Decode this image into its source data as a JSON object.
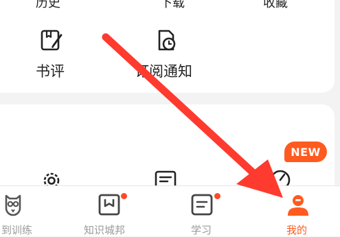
{
  "top_row": {
    "history_label": "历史",
    "download_label": "下载",
    "favorites_label": "收藏"
  },
  "grid": {
    "review_label": "书评",
    "subscription_label": "订阅通知"
  },
  "badge": {
    "new_label": "NEW"
  },
  "tabbar": {
    "tabs": [
      {
        "label": "到训练",
        "icon": "owl-icon"
      },
      {
        "label": "知识城邦",
        "icon": "bookmark-book-icon",
        "dot": true
      },
      {
        "label": "学习",
        "icon": "note-icon",
        "dot": true
      },
      {
        "label": "我的",
        "icon": "profile-icon",
        "active": true
      }
    ]
  },
  "colors": {
    "accent": "#ff5a1f",
    "arrow": "#ff3a2e",
    "text": "#222222",
    "muted": "#9a9a9a"
  }
}
